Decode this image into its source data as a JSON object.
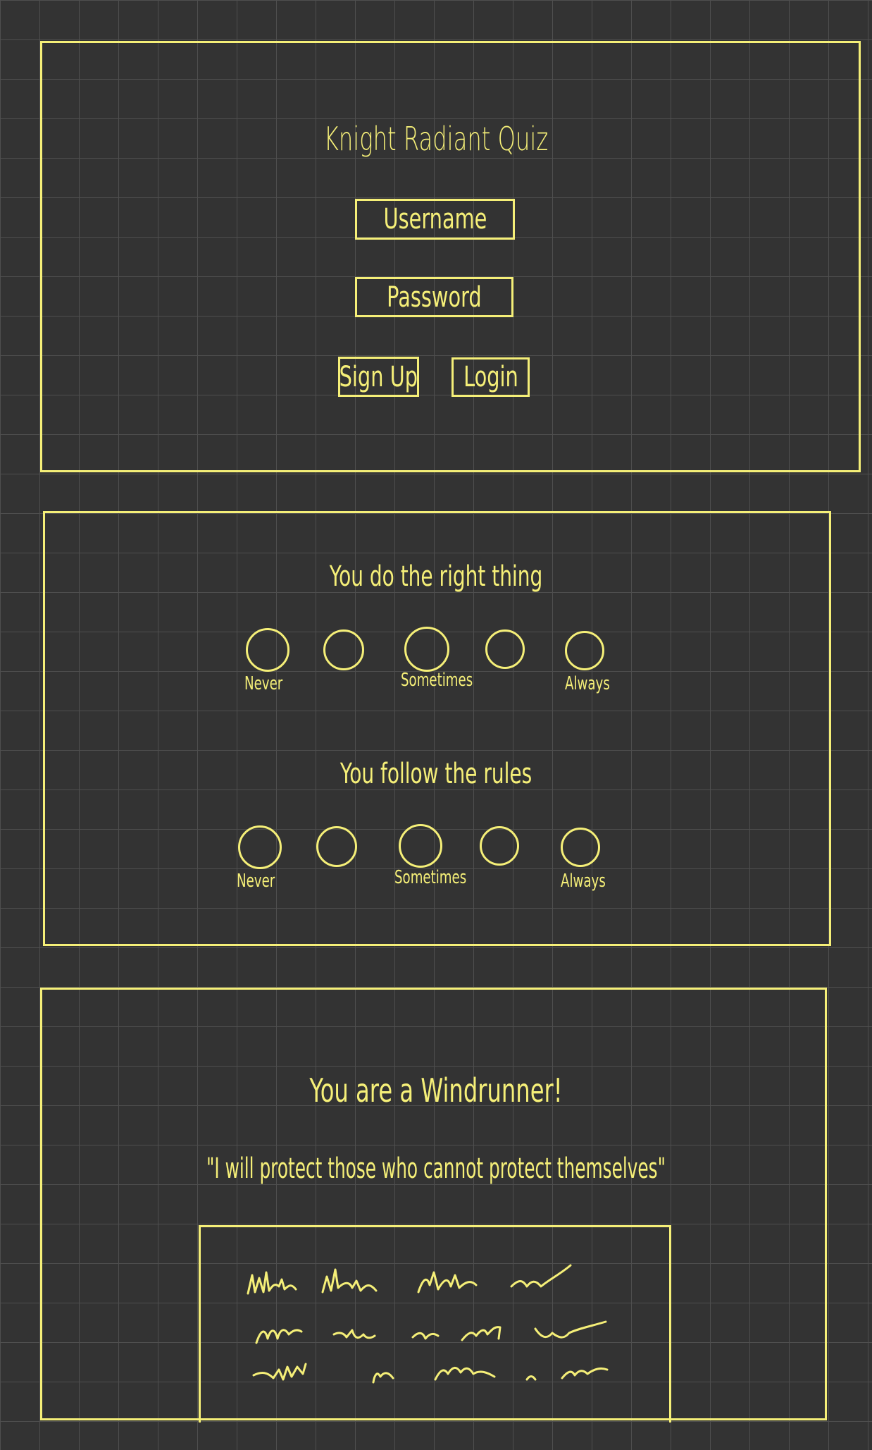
{
  "login": {
    "title": "Knight Radiant Quiz",
    "username_placeholder": "Username",
    "password_placeholder": "Password",
    "signup_label": "Sign Up",
    "login_label": "Login"
  },
  "quiz": {
    "questions": [
      {
        "text": "You do the right thing",
        "scale_labels": {
          "low": "Never",
          "mid": "Sometimes",
          "high": "Always"
        }
      },
      {
        "text": "You follow the rules",
        "scale_labels": {
          "low": "Never",
          "mid": "Sometimes",
          "high": "Always"
        }
      }
    ]
  },
  "result": {
    "heading": "You are a Windrunner!",
    "quote": "\"I will protect those who cannot protect themselves\""
  },
  "colors": {
    "background": "#333333",
    "grid": "#4f4f4f",
    "ink": "#f5ef78"
  }
}
